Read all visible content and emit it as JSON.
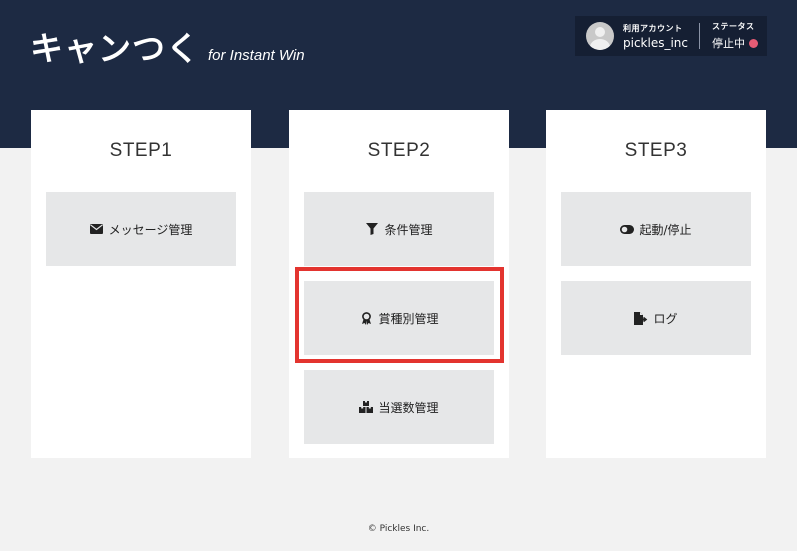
{
  "header": {
    "brand_main": "キャンつく",
    "brand_sub": "for Instant Win",
    "account_label": "利用アカウント",
    "account_name": "pickles_inc",
    "status_label": "ステータス",
    "status_value": "停止中",
    "status_color": "#e65c75",
    "background_color": "#1d2a43"
  },
  "steps": [
    {
      "title": "STEP1",
      "actions": [
        {
          "label": "メッセージ管理",
          "icon": "envelope-icon"
        }
      ]
    },
    {
      "title": "STEP2",
      "actions": [
        {
          "label": "条件管理",
          "icon": "filter-icon"
        },
        {
          "label": "賞種別管理",
          "icon": "award-icon",
          "highlighted": true
        },
        {
          "label": "当選数管理",
          "icon": "boxes-icon"
        }
      ]
    },
    {
      "title": "STEP3",
      "actions": [
        {
          "label": "起動/停止",
          "icon": "toggle-icon"
        },
        {
          "label": "ログ",
          "icon": "file-export-icon"
        }
      ]
    }
  ],
  "highlight_color": "#e3342f",
  "footer": {
    "copyright": "© Pickles Inc."
  }
}
